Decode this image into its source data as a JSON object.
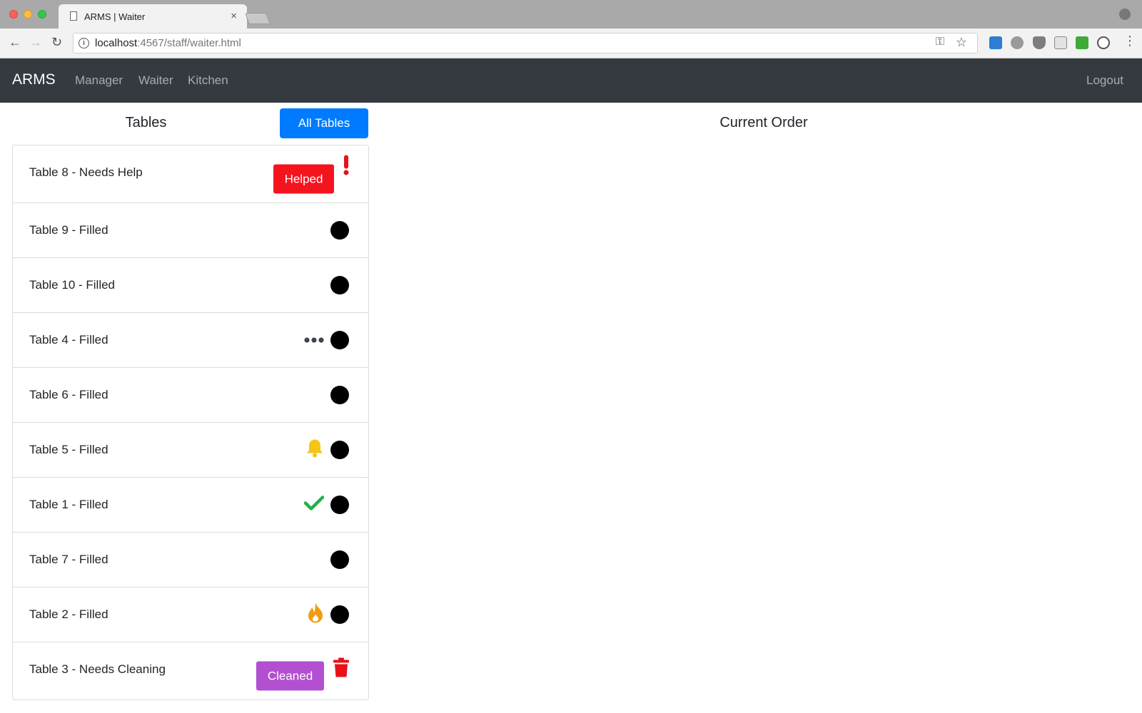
{
  "browser": {
    "tab_title": "ARMS | Waiter",
    "tab_close": "×",
    "url_host": "localhost",
    "url_path": ":4567/staff/waiter.html"
  },
  "nav": {
    "brand": "ARMS",
    "links": [
      "Manager",
      "Waiter",
      "Kitchen"
    ],
    "logout": "Logout"
  },
  "tables_panel": {
    "heading": "Tables",
    "all_tables_button": "All Tables"
  },
  "order_panel": {
    "heading": "Current Order"
  },
  "tables": [
    {
      "label": "Table 8 - Needs Help",
      "indicator": "exclamation-icon",
      "action": "Helped"
    },
    {
      "label": "Table 9 - Filled",
      "indicator": "none"
    },
    {
      "label": "Table 10 - Filled",
      "indicator": "none"
    },
    {
      "label": "Table 4 - Filled",
      "indicator": "ellipsis-icon"
    },
    {
      "label": "Table 6 - Filled",
      "indicator": "none"
    },
    {
      "label": "Table 5 - Filled",
      "indicator": "bell-icon"
    },
    {
      "label": "Table 1 - Filled",
      "indicator": "checkmark-icon"
    },
    {
      "label": "Table 7 - Filled",
      "indicator": "none"
    },
    {
      "label": "Table 2 - Filled",
      "indicator": "flame-icon"
    },
    {
      "label": "Table 3 - Needs Cleaning",
      "indicator": "trash-icon",
      "action": "Cleaned"
    }
  ],
  "colors": {
    "navbar": "#343a40",
    "primary_button": "#007bff",
    "helped_button": "#f5141e",
    "cleaned_button": "#b350d1",
    "bell": "#f5c518",
    "check": "#22b14c",
    "flame": "#f39c12",
    "trash": "#e8101a",
    "exclamation": "#e8101a"
  }
}
